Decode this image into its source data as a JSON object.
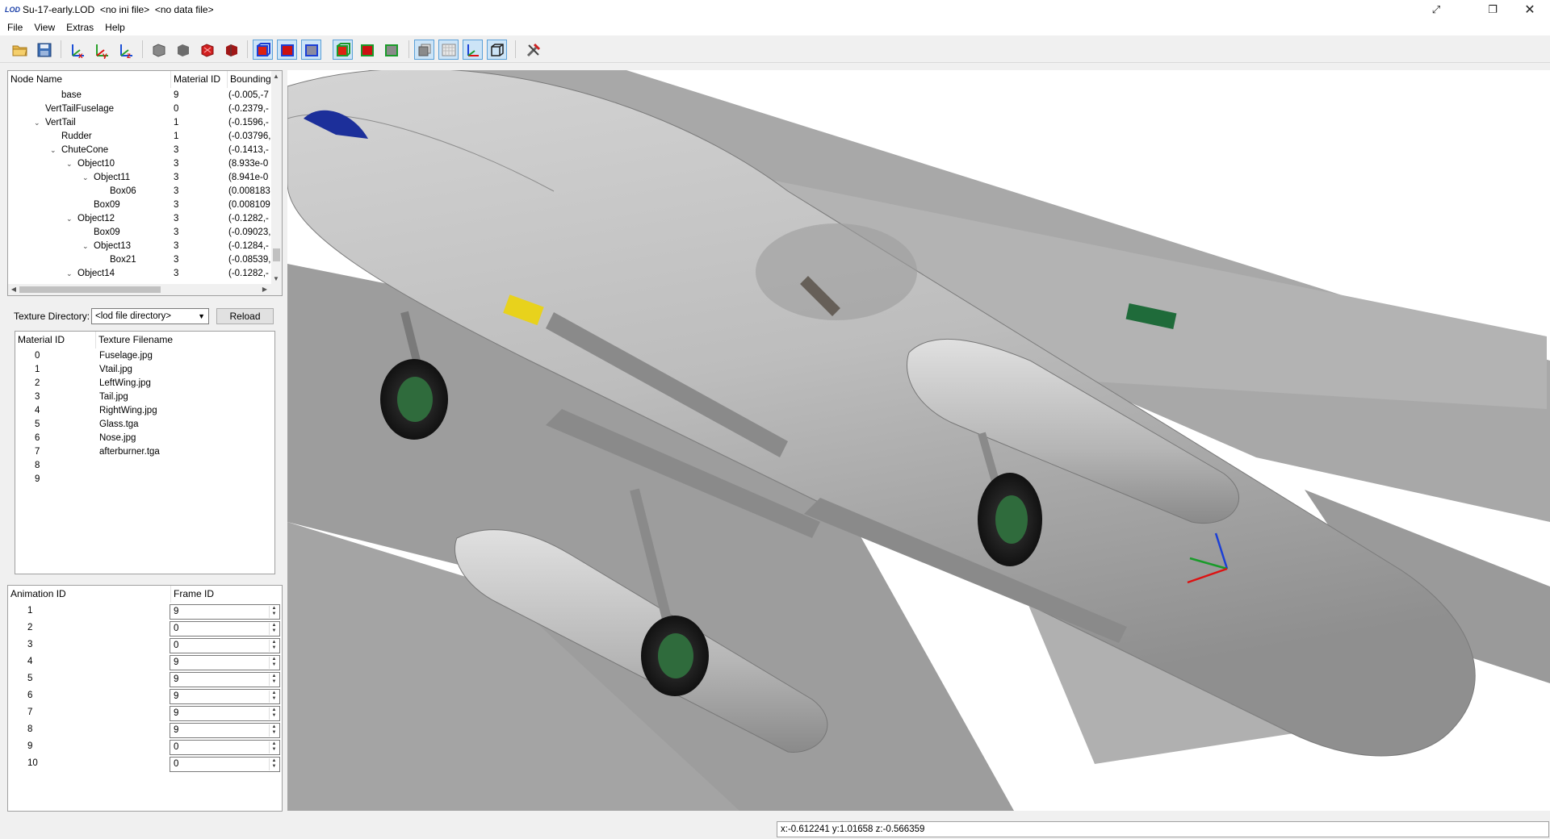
{
  "window": {
    "app_icon": "LOD",
    "title": "Su-17-early.LOD  <no ini file>  <no data file>",
    "controls": [
      "fullscreen-toggle-icon",
      "restore-icon",
      "close-icon"
    ]
  },
  "menu": [
    "File",
    "View",
    "Extras",
    "Help"
  ],
  "toolbar": {
    "buttons": [
      {
        "name": "open-folder-icon"
      },
      {
        "name": "save-icon"
      },
      {
        "name": "reset-x-axis-icon"
      },
      {
        "name": "reset-y-axis-icon"
      },
      {
        "name": "reset-z-axis-icon"
      },
      {
        "name": "render-solid-gray-icon"
      },
      {
        "name": "render-flat-gray-icon"
      },
      {
        "name": "render-solid-red-icon"
      },
      {
        "name": "render-dark-red-icon"
      },
      {
        "name": "bbox-blue-wire-icon",
        "active": true
      },
      {
        "name": "bbox-blue-solid-icon",
        "active": true
      },
      {
        "name": "bbox-blue-outline-icon",
        "active": true
      },
      {
        "name": "bbox-green-wire-icon",
        "active": true
      },
      {
        "name": "bbox-green-solid-icon"
      },
      {
        "name": "bbox-green-outline-icon"
      },
      {
        "name": "texture-toggle-icon",
        "active": true
      },
      {
        "name": "grid-toggle-icon",
        "active": true
      },
      {
        "name": "axes-toggle-icon",
        "active": true
      },
      {
        "name": "box-outline-icon",
        "active": true
      },
      {
        "name": "tools-icon"
      }
    ]
  },
  "node_tree": {
    "columns": [
      "Node Name",
      "Material ID",
      "Bounding"
    ],
    "rows": [
      {
        "name": "base",
        "material": "9",
        "bbox": "(-0.005,-7",
        "depth": 3,
        "expander": ""
      },
      {
        "name": "VertTailFuselage",
        "material": "0",
        "bbox": "(-0.2379,-",
        "depth": 2,
        "expander": ""
      },
      {
        "name": "VertTail",
        "material": "1",
        "bbox": "(-0.1596,-",
        "depth": 2,
        "expander": "v"
      },
      {
        "name": "Rudder",
        "material": "1",
        "bbox": "(-0.03796,",
        "depth": 3,
        "expander": ""
      },
      {
        "name": "ChuteCone",
        "material": "3",
        "bbox": "(-0.1413,-",
        "depth": 3,
        "expander": "v"
      },
      {
        "name": "Object10",
        "material": "3",
        "bbox": "(8.933e-0",
        "depth": 4,
        "expander": "v"
      },
      {
        "name": "Object11",
        "material": "3",
        "bbox": "(8.941e-0",
        "depth": 5,
        "expander": "v"
      },
      {
        "name": "Box06",
        "material": "3",
        "bbox": "(0.008183",
        "depth": 6,
        "expander": ""
      },
      {
        "name": "Box09",
        "material": "3",
        "bbox": "(0.008109",
        "depth": 5,
        "expander": ""
      },
      {
        "name": "Object12",
        "material": "3",
        "bbox": "(-0.1282,-",
        "depth": 4,
        "expander": "v"
      },
      {
        "name": "Box09",
        "material": "3",
        "bbox": "(-0.09023,",
        "depth": 5,
        "expander": ""
      },
      {
        "name": "Object13",
        "material": "3",
        "bbox": "(-0.1284,-",
        "depth": 5,
        "expander": "v"
      },
      {
        "name": "Box21",
        "material": "3",
        "bbox": "(-0.08539,",
        "depth": 6,
        "expander": ""
      },
      {
        "name": "Object14",
        "material": "3",
        "bbox": "(-0.1282,-",
        "depth": 4,
        "expander": "v"
      }
    ]
  },
  "texture_directory": {
    "label": "Texture Directory:",
    "selected": "<lod file directory>",
    "reload_label": "Reload"
  },
  "textures": {
    "columns": [
      "Material ID",
      "Texture Filename"
    ],
    "rows": [
      {
        "id": "0",
        "file": "Fuselage.jpg"
      },
      {
        "id": "1",
        "file": "Vtail.jpg"
      },
      {
        "id": "2",
        "file": "LeftWing.jpg"
      },
      {
        "id": "3",
        "file": "Tail.jpg"
      },
      {
        "id": "4",
        "file": "RightWing.jpg"
      },
      {
        "id": "5",
        "file": "Glass.tga"
      },
      {
        "id": "6",
        "file": "Nose.jpg"
      },
      {
        "id": "7",
        "file": "afterburner.tga"
      },
      {
        "id": "8",
        "file": ""
      },
      {
        "id": "9",
        "file": ""
      }
    ]
  },
  "animations": {
    "columns": [
      "Animation ID",
      "Frame ID"
    ],
    "rows": [
      {
        "id": "1",
        "frame": "9"
      },
      {
        "id": "2",
        "frame": "0"
      },
      {
        "id": "3",
        "frame": "0"
      },
      {
        "id": "4",
        "frame": "9"
      },
      {
        "id": "5",
        "frame": "9"
      },
      {
        "id": "6",
        "frame": "9"
      },
      {
        "id": "7",
        "frame": "9"
      },
      {
        "id": "8",
        "frame": "9"
      },
      {
        "id": "9",
        "frame": "0"
      },
      {
        "id": "10",
        "frame": "0"
      }
    ]
  },
  "viewport": {
    "subject": "3d-aircraft-model-render",
    "colors": {
      "body": "#b9b9b9",
      "tire": "#1c1c1c",
      "hub": "#2f6b3c",
      "stripe": "#1f6b3a",
      "warning": "#e8d21c"
    }
  },
  "status": {
    "coords": "x:-0.612241 y:1.01658 z:-0.566359"
  }
}
